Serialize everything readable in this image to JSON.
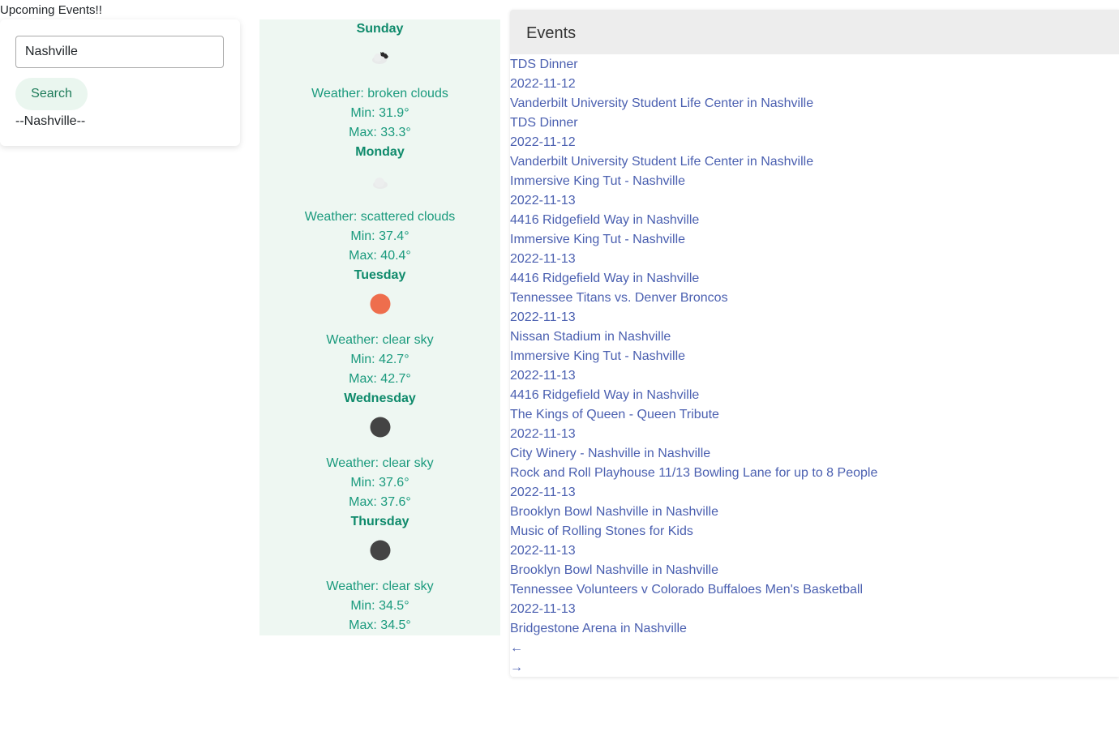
{
  "page": {
    "heading": "Upcoming Events!!"
  },
  "search": {
    "input_value": "Nashville",
    "button_label": "Search",
    "city_label": "--Nashville--"
  },
  "colors": {
    "weather_text": "#1a9a7d",
    "weather_bg": "#eef7f2",
    "link": "#4a5fb0",
    "clear_day_icon": "#ee6e4d",
    "clear_night_icon": "#444444"
  },
  "weather": {
    "days": [
      {
        "day": "Sunday",
        "icon": "broken-clouds-icon",
        "desc": "Weather: broken clouds",
        "min": "Min: 31.9°",
        "max": "Max: 33.3°"
      },
      {
        "day": "Monday",
        "icon": "scattered-clouds-icon",
        "desc": "Weather: scattered clouds",
        "min": "Min: 37.4°",
        "max": "Max: 40.4°"
      },
      {
        "day": "Tuesday",
        "icon": "clear-sky-day-icon",
        "desc": "Weather: clear sky",
        "min": "Min: 42.7°",
        "max": "Max: 42.7°"
      },
      {
        "day": "Wednesday",
        "icon": "clear-sky-night-icon",
        "desc": "Weather: clear sky",
        "min": "Min: 37.6°",
        "max": "Max: 37.6°"
      },
      {
        "day": "Thursday",
        "icon": "clear-sky-night-icon",
        "desc": "Weather: clear sky",
        "min": "Min: 34.5°",
        "max": "Max: 34.5°"
      }
    ]
  },
  "events": {
    "title": "Events",
    "items": [
      {
        "name": "TDS Dinner",
        "date": "2022-11-12",
        "venue": "Vanderbilt University Student Life Center in Nashville"
      },
      {
        "name": "TDS Dinner",
        "date": "2022-11-12",
        "venue": "Vanderbilt University Student Life Center in Nashville"
      },
      {
        "name": "Immersive King Tut - Nashville",
        "date": "2022-11-13",
        "venue": "4416 Ridgefield Way in Nashville"
      },
      {
        "name": "Immersive King Tut - Nashville",
        "date": "2022-11-13",
        "venue": "4416 Ridgefield Way in Nashville"
      },
      {
        "name": "Tennessee Titans vs. Denver Broncos",
        "date": "2022-11-13",
        "venue": "Nissan Stadium in Nashville"
      },
      {
        "name": "Immersive King Tut - Nashville",
        "date": "2022-11-13",
        "venue": "4416 Ridgefield Way in Nashville"
      },
      {
        "name": "The Kings of Queen - Queen Tribute",
        "date": "2022-11-13",
        "venue": "City Winery - Nashville in Nashville"
      },
      {
        "name": "Rock and Roll Playhouse 11/13 Bowling Lane for up to 8 People",
        "date": "2022-11-13",
        "venue": "Brooklyn Bowl Nashville in Nashville"
      },
      {
        "name": "Music of Rolling Stones for Kids",
        "date": "2022-11-13",
        "venue": "Brooklyn Bowl Nashville in Nashville"
      },
      {
        "name": "Tennessee Volunteers v Colorado Buffaloes Men's Basketball",
        "date": "2022-11-13",
        "venue": "Bridgestone Arena in Nashville"
      }
    ],
    "prev_label": "←",
    "next_label": "→"
  }
}
